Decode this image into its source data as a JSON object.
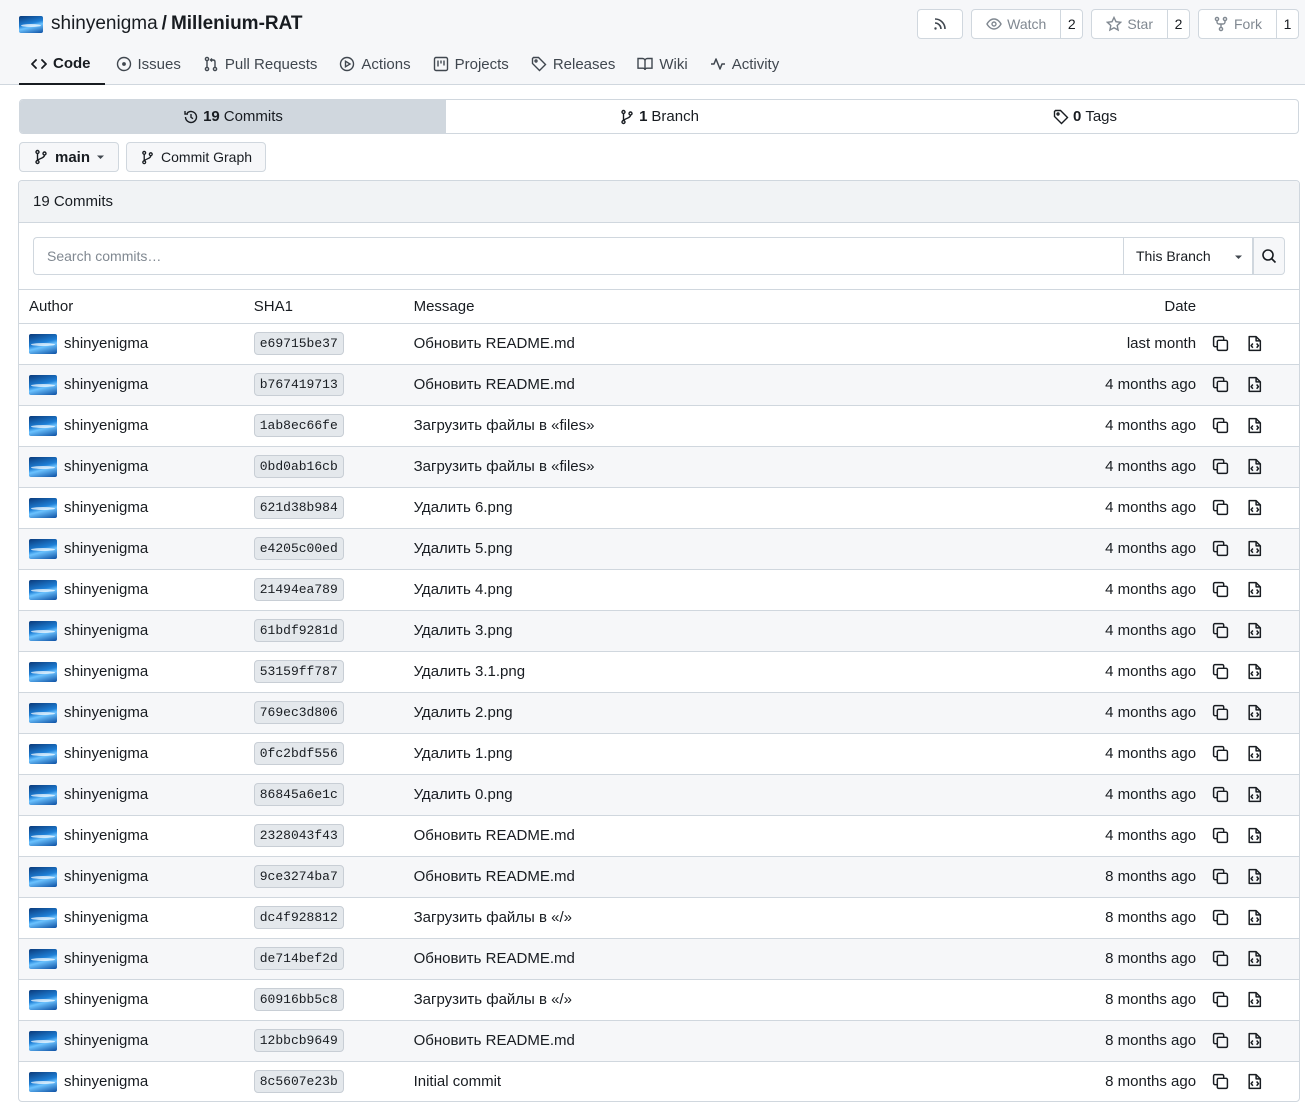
{
  "repo": {
    "owner": "shinyenigma",
    "separator": "/",
    "name": "Millenium-RAT",
    "watch_label": "Watch",
    "watch_count": "2",
    "star_label": "Star",
    "star_count": "2",
    "fork_label": "Fork",
    "fork_count": "1"
  },
  "tabs": [
    {
      "label": "Code",
      "icon": "code-icon",
      "active": true
    },
    {
      "label": "Issues",
      "icon": "issue-icon"
    },
    {
      "label": "Pull Requests",
      "icon": "pull-request-icon"
    },
    {
      "label": "Actions",
      "icon": "play-icon"
    },
    {
      "label": "Projects",
      "icon": "project-icon"
    },
    {
      "label": "Releases",
      "icon": "tag-icon"
    },
    {
      "label": "Wiki",
      "icon": "book-icon"
    },
    {
      "label": "Activity",
      "icon": "pulse-icon"
    }
  ],
  "summary": {
    "commits_count": "19",
    "commits_label": "Commits",
    "branch_count": "1",
    "branch_label": "Branch",
    "tags_count": "0",
    "tags_label": "Tags"
  },
  "branch": {
    "current": "main",
    "graph_label": "Commit Graph"
  },
  "commits_box": {
    "title": "19 Commits",
    "search_placeholder": "Search commits…",
    "scope": "This Branch"
  },
  "table": {
    "headers": {
      "author": "Author",
      "sha": "SHA1",
      "message": "Message",
      "date": "Date"
    },
    "rows": [
      {
        "author": "shinyenigma",
        "sha": "e69715be37",
        "message": "Обновить README.md",
        "date": "last month"
      },
      {
        "author": "shinyenigma",
        "sha": "b767419713",
        "message": "Обновить README.md",
        "date": "4 months ago"
      },
      {
        "author": "shinyenigma",
        "sha": "1ab8ec66fe",
        "message": "Загрузить файлы в «files»",
        "date": "4 months ago"
      },
      {
        "author": "shinyenigma",
        "sha": "0bd0ab16cb",
        "message": "Загрузить файлы в «files»",
        "date": "4 months ago"
      },
      {
        "author": "shinyenigma",
        "sha": "621d38b984",
        "message": "Удалить 6.png",
        "date": "4 months ago"
      },
      {
        "author": "shinyenigma",
        "sha": "e4205c00ed",
        "message": "Удалить 5.png",
        "date": "4 months ago"
      },
      {
        "author": "shinyenigma",
        "sha": "21494ea789",
        "message": "Удалить 4.png",
        "date": "4 months ago"
      },
      {
        "author": "shinyenigma",
        "sha": "61bdf9281d",
        "message": "Удалить 3.png",
        "date": "4 months ago"
      },
      {
        "author": "shinyenigma",
        "sha": "53159ff787",
        "message": "Удалить 3.1.png",
        "date": "4 months ago"
      },
      {
        "author": "shinyenigma",
        "sha": "769ec3d806",
        "message": "Удалить 2.png",
        "date": "4 months ago"
      },
      {
        "author": "shinyenigma",
        "sha": "0fc2bdf556",
        "message": "Удалить 1.png",
        "date": "4 months ago"
      },
      {
        "author": "shinyenigma",
        "sha": "86845a6e1c",
        "message": "Удалить 0.png",
        "date": "4 months ago"
      },
      {
        "author": "shinyenigma",
        "sha": "2328043f43",
        "message": "Обновить README.md",
        "date": "4 months ago"
      },
      {
        "author": "shinyenigma",
        "sha": "9ce3274ba7",
        "message": "Обновить README.md",
        "date": "8 months ago"
      },
      {
        "author": "shinyenigma",
        "sha": "dc4f928812",
        "message": "Загрузить файлы в «/»",
        "date": "8 months ago"
      },
      {
        "author": "shinyenigma",
        "sha": "de714bef2d",
        "message": "Обновить README.md",
        "date": "8 months ago"
      },
      {
        "author": "shinyenigma",
        "sha": "60916bb5c8",
        "message": "Загрузить файлы в «/»",
        "date": "8 months ago"
      },
      {
        "author": "shinyenigma",
        "sha": "12bbcb9649",
        "message": "Обновить README.md",
        "date": "8 months ago"
      },
      {
        "author": "shinyenigma",
        "sha": "8c5607e23b",
        "message": "Initial commit",
        "date": "8 months ago"
      }
    ]
  },
  "colors": {
    "header_bg": "#f6f7f9",
    "border": "#d0d7de",
    "active_segment": "#d0d7de",
    "text": "#181c21",
    "muted": "#808891"
  }
}
